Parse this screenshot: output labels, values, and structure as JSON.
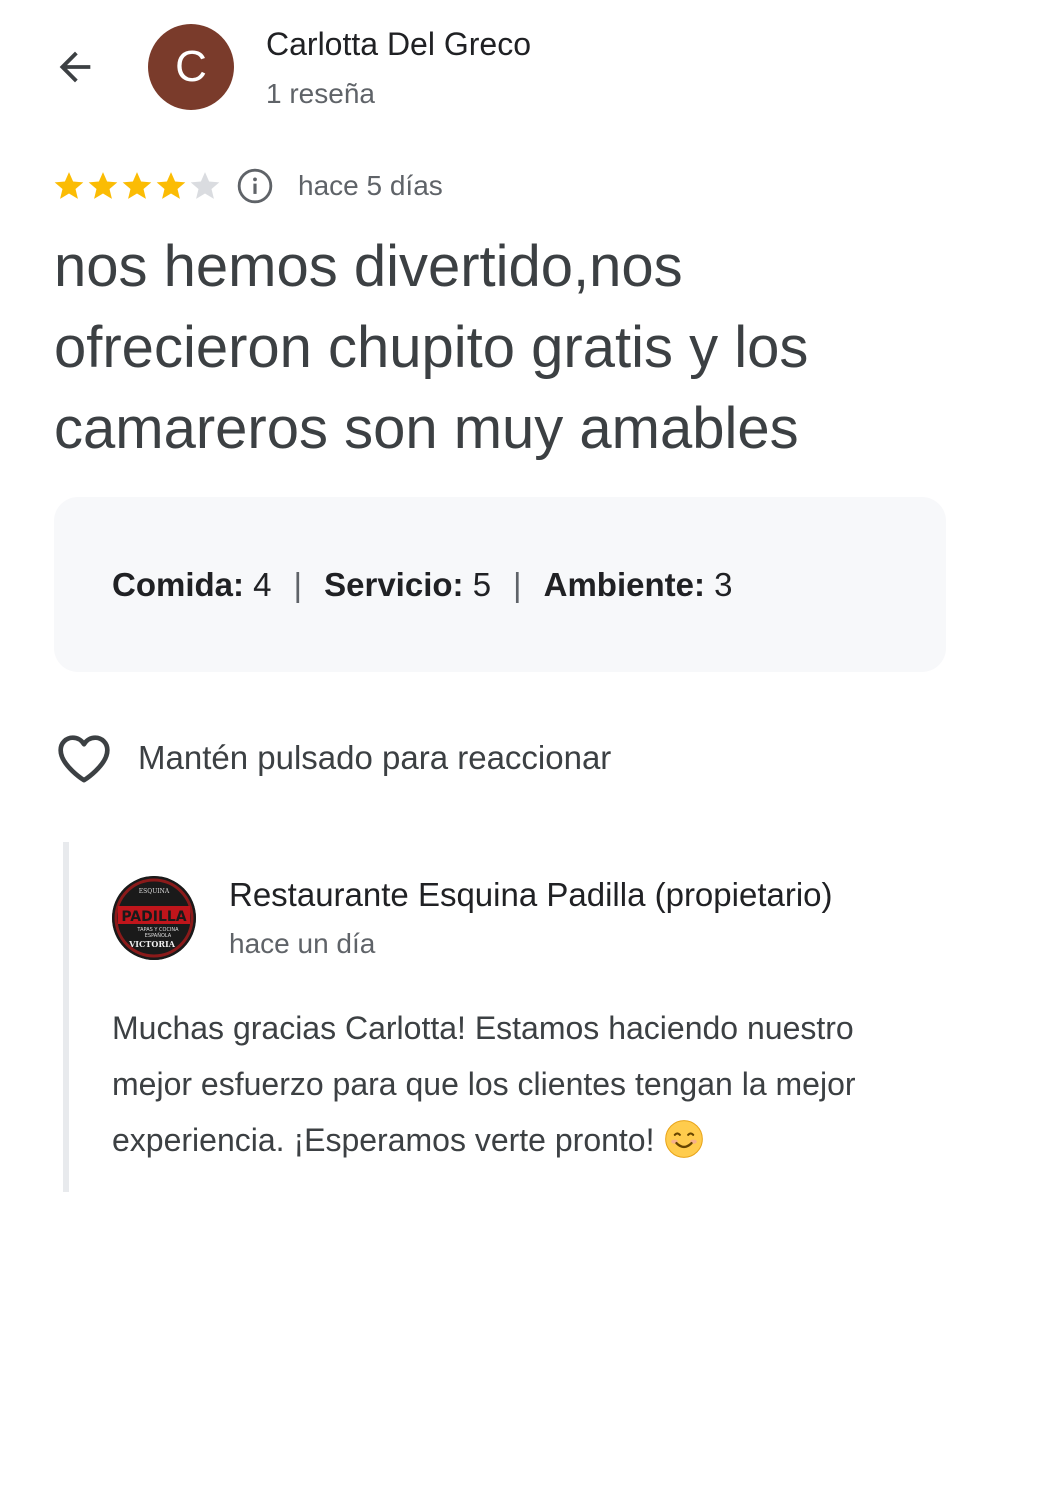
{
  "header": {
    "back_icon": "arrow-left-icon",
    "author_initial": "C",
    "author_name": "Carlotta Del Greco",
    "author_meta": "1 reseña",
    "avatar_color": "#7a3b2b"
  },
  "review": {
    "rating": 4,
    "max_rating": 5,
    "star_color": "#fbbc04",
    "date": "hace 5 días",
    "text": "nos hemos divertido,nos ofrecieron chupito gratis y los camareros son muy amables",
    "aspects": [
      {
        "label": "Comida:",
        "value": "4"
      },
      {
        "label": "Servicio:",
        "value": "5"
      },
      {
        "label": "Ambiente:",
        "value": "3"
      }
    ],
    "separator": "|"
  },
  "reaction": {
    "icon": "heart-outline-icon",
    "label": "Mantén pulsado para reaccionar"
  },
  "owner_reply": {
    "logo": "restaurant-logo",
    "logo_text": [
      "ESQUINA",
      "PADILLA",
      "TAPAS Y COCINA",
      "ESPAÑOLA",
      "VICTORIA"
    ],
    "name": "Restaurante Esquina Padilla (propietario)",
    "date": "hace un día",
    "text": "Muchas gracias Carlotta! Estamos haciendo nuestro mejor esfuerzo para que los clientes tengan la mejor experiencia. ¡Esperamos verte pronto!",
    "emoji": "smiling-face-icon"
  }
}
